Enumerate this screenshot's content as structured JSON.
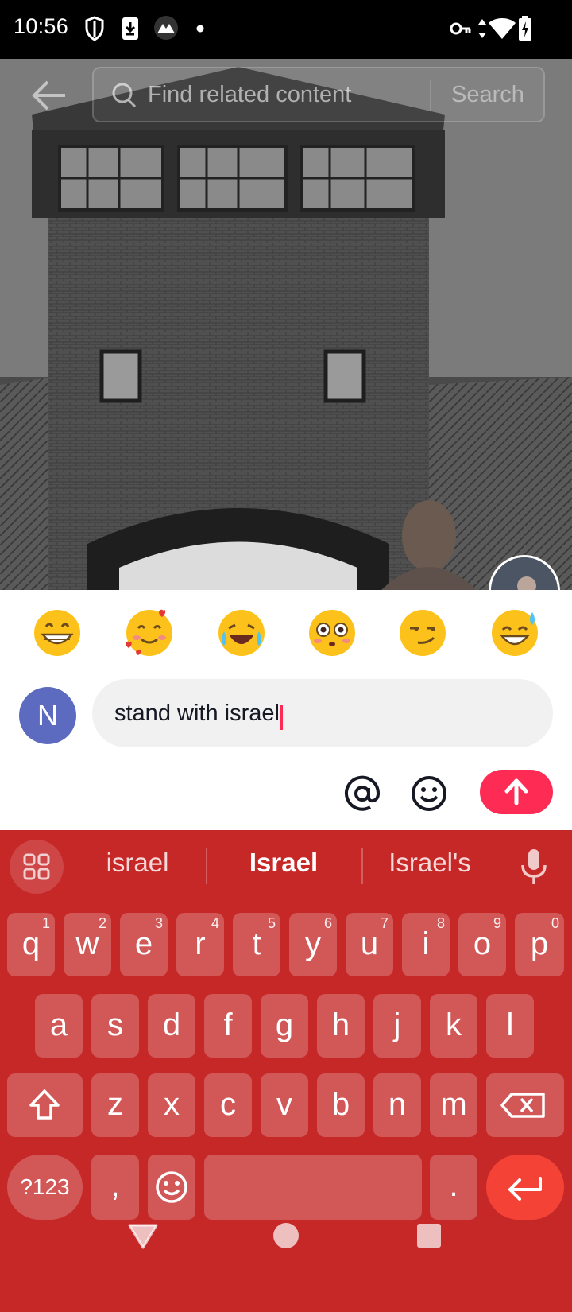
{
  "status_bar": {
    "time": "10:56",
    "icons_left": [
      "shield-icon",
      "download-icon",
      "app-icon",
      "dot-icon"
    ],
    "icons_right": [
      "key-icon",
      "data-arrows-icon",
      "wifi-icon",
      "battery-charging-icon"
    ]
  },
  "search": {
    "placeholder": "Find related content",
    "button_label": "Search"
  },
  "quick_emojis": [
    "😁",
    "🥰",
    "😂",
    "😳",
    "😏",
    "😅"
  ],
  "comment": {
    "avatar_initial": "N",
    "text": "stand with israel"
  },
  "keyboard": {
    "suggestions": [
      "israel",
      "Israel",
      "Israel's"
    ],
    "rows": [
      [
        {
          "k": "q",
          "h": "1"
        },
        {
          "k": "w",
          "h": "2"
        },
        {
          "k": "e",
          "h": "3"
        },
        {
          "k": "r",
          "h": "4"
        },
        {
          "k": "t",
          "h": "5"
        },
        {
          "k": "y",
          "h": "6"
        },
        {
          "k": "u",
          "h": "7"
        },
        {
          "k": "i",
          "h": "8"
        },
        {
          "k": "o",
          "h": "9"
        },
        {
          "k": "p",
          "h": "0"
        }
      ],
      [
        {
          "k": "a"
        },
        {
          "k": "s"
        },
        {
          "k": "d"
        },
        {
          "k": "f"
        },
        {
          "k": "g"
        },
        {
          "k": "h"
        },
        {
          "k": "j"
        },
        {
          "k": "k"
        },
        {
          "k": "l"
        }
      ],
      [
        {
          "k": "z"
        },
        {
          "k": "x"
        },
        {
          "k": "c"
        },
        {
          "k": "v"
        },
        {
          "k": "b"
        },
        {
          "k": "n"
        },
        {
          "k": "m"
        }
      ]
    ],
    "symbols_label": "?123",
    "comma_label": ",",
    "period_label": "."
  },
  "colors": {
    "accent": "#fe2c55",
    "keyboard_bg": "#c62828",
    "enter_key": "#f44336",
    "avatar_bg": "#5c6bc0"
  }
}
